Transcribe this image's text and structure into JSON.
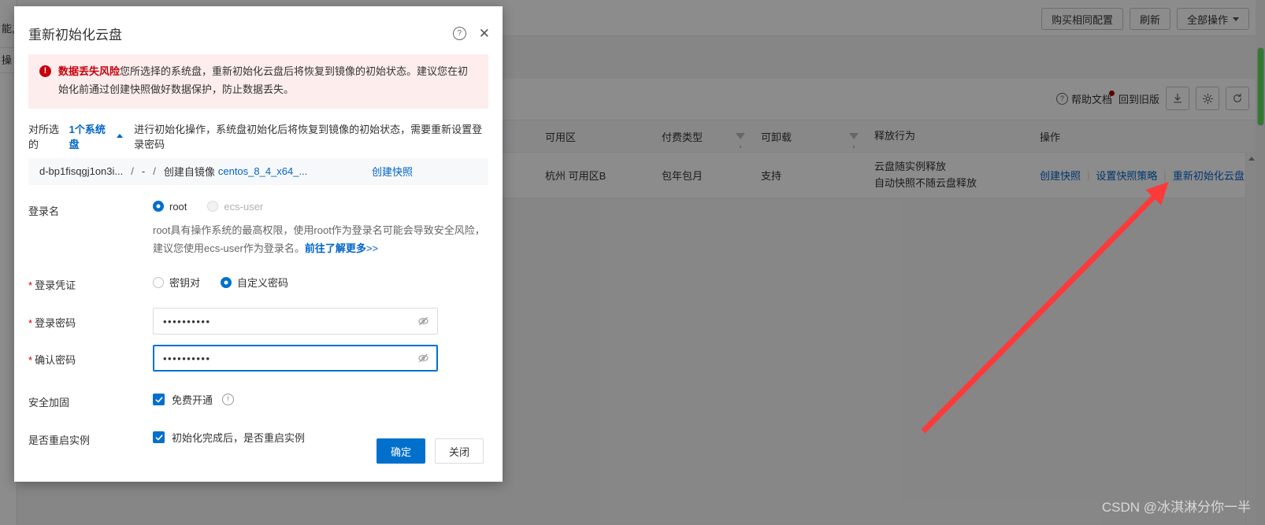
{
  "background": {
    "left_rail_fragments": [
      "能,",
      "操"
    ],
    "topbar": {
      "buttons": [
        {
          "label": "购买相同配置",
          "icon": null
        },
        {
          "label": "刷新",
          "icon": null
        },
        {
          "label": "全部操作",
          "icon": "chevron-down-icon"
        }
      ]
    },
    "toolbar": {
      "help_link": "帮助文档",
      "old_version_link": "回到旧版",
      "icons": [
        "download-icon",
        "gear-icon",
        "refresh-icon"
      ]
    },
    "table": {
      "columns": [
        "可用区",
        "付费类型",
        "可卸载",
        "释放行为",
        "操作"
      ],
      "rows": [
        {
          "az": "杭州 可用区B",
          "pay_type": "包年包月",
          "detachable": "支持",
          "release_behavior_line1": "云盘随实例释放",
          "release_behavior_line2": "自动快照不随云盘释放",
          "ops": [
            "创建快照",
            "设置快照策略",
            "重新初始化云盘"
          ],
          "more_icon": "kebab-menu-icon"
        }
      ]
    }
  },
  "modal": {
    "title": "重新初始化云盘",
    "help_icon": "question-circle-icon",
    "close_icon": "close-icon",
    "alert": {
      "icon": "error-exclamation-icon",
      "strong": "数据丢失风险",
      "text": "您所选择的系统盘，重新初始化云盘后将恢复到镜像的初始状态。建议您在初始化前通过创建快照做好数据保护，防止数据丢失。"
    },
    "selection": {
      "prefix": "对所选的",
      "link": "1个系统盘",
      "caret_icon": "caret-up-icon",
      "suffix": "进行初始化操作，系统盘初始化后将恢复到镜像的初始状态，需要重新设置登录密码"
    },
    "disk": {
      "id": "d-bp1fisqgj1on3i...",
      "size": "-",
      "source_label": "创建自镜像",
      "image": "centos_8_4_x64_...",
      "action_link": "创建快照"
    },
    "form": {
      "login_name": {
        "label": "登录名",
        "required": false,
        "options": [
          {
            "value": "root",
            "selected": true,
            "disabled": false
          },
          {
            "value": "ecs-user",
            "selected": false,
            "disabled": true
          }
        ],
        "help_prefix": "root具有操作系统的最高权限，使用root作为登录名可能会导致安全风险，建议您使用ecs-user作为登录名。",
        "help_link": "前往了解更多",
        "help_link_suffix": ">>"
      },
      "credential": {
        "label": "登录凭证",
        "required": true,
        "options": [
          {
            "value": "密钥对",
            "selected": false
          },
          {
            "value": "自定义密码",
            "selected": true
          }
        ]
      },
      "password": {
        "label": "登录密码",
        "required": true,
        "value": "••••••••••",
        "placeholder": "",
        "toggle_icon": "eye-slash-icon",
        "focused": false
      },
      "confirm_password": {
        "label": "确认密码",
        "required": true,
        "value": "••••••••••",
        "placeholder": "",
        "toggle_icon": "eye-slash-icon",
        "focused": true
      },
      "security_hardening": {
        "label": "安全加固",
        "checkbox_label": "免费开通",
        "checked": true,
        "info_icon": "info-circle-icon"
      },
      "restart_instance": {
        "label": "是否重启实例",
        "checkbox_label": "初始化完成后，是否重启实例",
        "checked": true
      }
    },
    "footer": {
      "confirm_label": "确定",
      "close_label": "关闭"
    }
  },
  "annotation": {
    "arrow_color": "#fc3a3a",
    "target": "重新初始化云盘"
  },
  "watermark": "CSDN @冰淇淋分你一半",
  "colors": {
    "primary": "#0070cc",
    "link": "#0064c8",
    "danger": "#c7000b",
    "alert_bg": "#fdeded",
    "table_header_bg": "#f7f8fa",
    "arrow": "#fc3a3a"
  }
}
